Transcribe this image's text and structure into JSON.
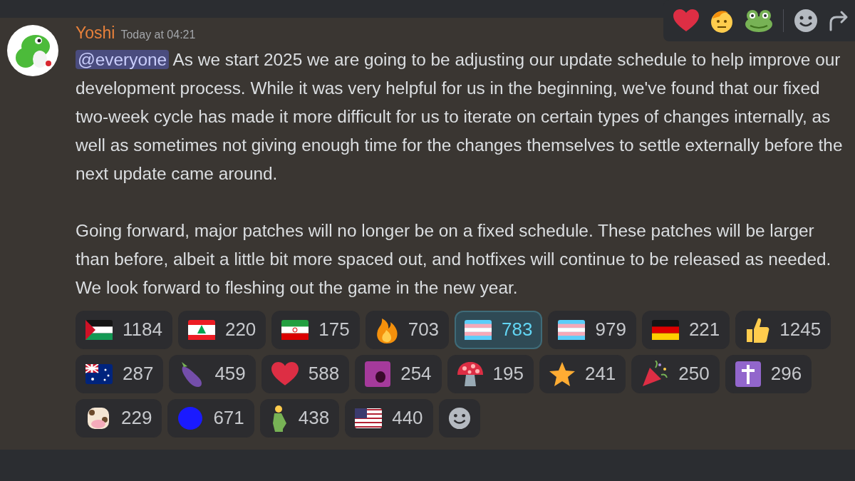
{
  "message": {
    "author": "Yoshi",
    "timestamp": "Today at 04:21",
    "mention": "@everyone",
    "paragraphs": [
      "As we start 2025 we are going to be adjusting our update schedule to help improve our development process. While it was very helpful for us in the beginning, we've found that our fixed two-week cycle has made it more difficult for us to iterate on certain types of changes internally, as well as sometimes not giving enough time for the changes themselves to settle externally before the next update came around.",
      "Going forward, major patches will no longer be on a fixed schedule. These patches will be larger than before, albeit a little bit more spaced out, and hotfixes will continue to be released as needed. We look forward to fleshing out the game in the new year."
    ]
  },
  "reactions": [
    {
      "count": "1184",
      "selected": false
    },
    {
      "count": "220",
      "selected": false
    },
    {
      "count": "175",
      "selected": false
    },
    {
      "count": "703",
      "selected": false
    },
    {
      "count": "783",
      "selected": true
    },
    {
      "count": "979",
      "selected": false
    },
    {
      "count": "221",
      "selected": false
    },
    {
      "count": "1245",
      "selected": false
    },
    {
      "count": "287",
      "selected": false
    },
    {
      "count": "459",
      "selected": false
    },
    {
      "count": "588",
      "selected": false
    },
    {
      "count": "254",
      "selected": false
    },
    {
      "count": "195",
      "selected": false
    },
    {
      "count": "241",
      "selected": false
    },
    {
      "count": "250",
      "selected": false
    },
    {
      "count": "296",
      "selected": false
    },
    {
      "count": "229",
      "selected": false
    },
    {
      "count": "671",
      "selected": false
    },
    {
      "count": "438",
      "selected": false
    },
    {
      "count": "440",
      "selected": false
    }
  ]
}
